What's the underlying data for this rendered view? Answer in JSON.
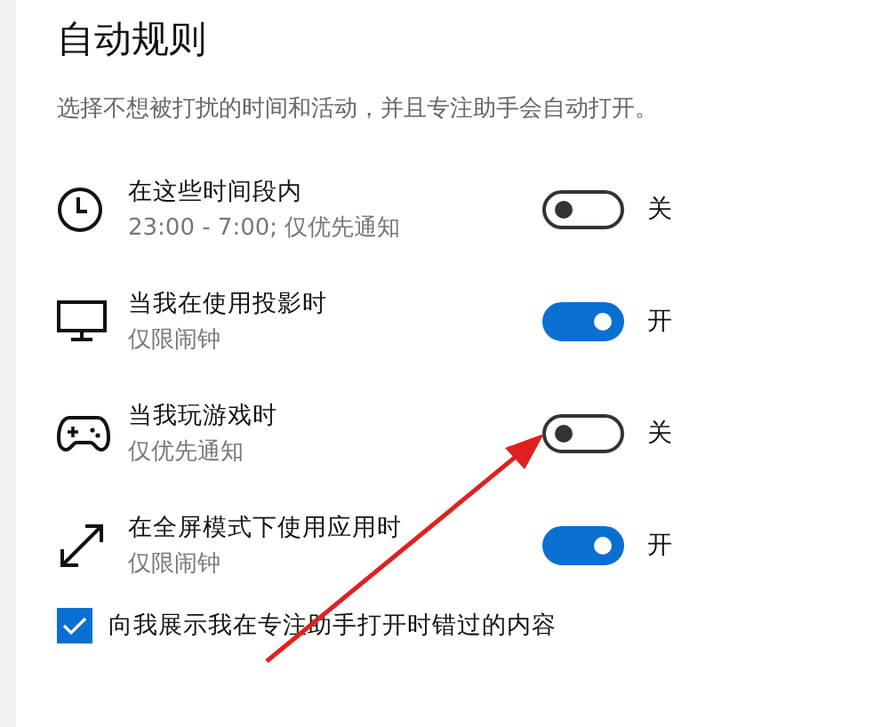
{
  "title": "自动规则",
  "description": "选择不想被打扰的时间和活动，并且专注助手会自动打开。",
  "rules": [
    {
      "kind": "clock",
      "name": "在这些时间段内",
      "detail": "23:00 - 7:00; 仅优先通知",
      "on": false,
      "state_label": "关"
    },
    {
      "kind": "monitor",
      "name": "当我在使用投影时",
      "detail": "仅限闹钟",
      "on": true,
      "state_label": "开"
    },
    {
      "kind": "gamepad",
      "name": "当我玩游戏时",
      "detail": "仅优先通知",
      "on": false,
      "state_label": "关"
    },
    {
      "kind": "expand",
      "name": "在全屏模式下使用应用时",
      "detail": "仅限闹钟",
      "on": true,
      "state_label": "开"
    }
  ],
  "show_missed": {
    "label": "向我展示我在专注助手打开时错过的内容",
    "checked": true
  }
}
